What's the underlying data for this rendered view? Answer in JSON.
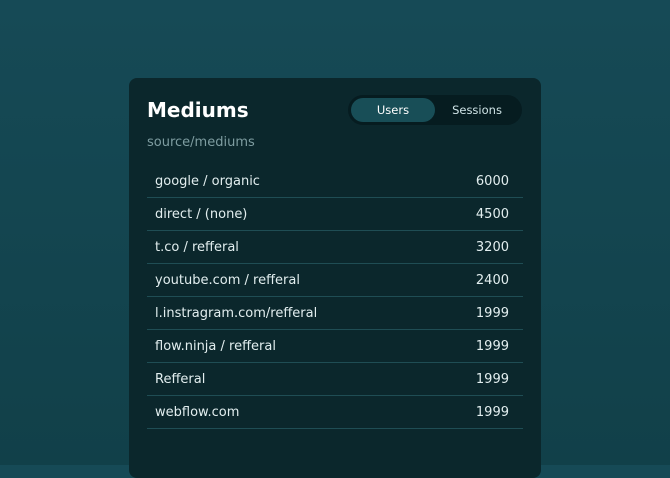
{
  "card": {
    "title": "Mediums",
    "subtitle": "source/mediums",
    "toggle": {
      "users_label": "Users",
      "sessions_label": "Sessions",
      "selected": "Users"
    },
    "rows": [
      {
        "label": "google / organic",
        "value": "6000"
      },
      {
        "label": "direct / (none)",
        "value": "4500"
      },
      {
        "label": "t.co / refferal",
        "value": "3200"
      },
      {
        "label": "youtube.com / refferal",
        "value": "2400"
      },
      {
        "label": "l.instragram.com/refferal",
        "value": "1999"
      },
      {
        "label": "flow.ninja / refferal",
        "value": "1999"
      },
      {
        "label": "Refferal",
        "value": "1999"
      },
      {
        "label": "webflow.com",
        "value": "1999"
      }
    ]
  },
  "colors": {
    "background": "#164a56",
    "card": "#0b272c",
    "toggle_track": "#061c20",
    "toggle_active": "#184e57",
    "divider": "#1f4d54",
    "muted_text": "#7e9da1"
  }
}
